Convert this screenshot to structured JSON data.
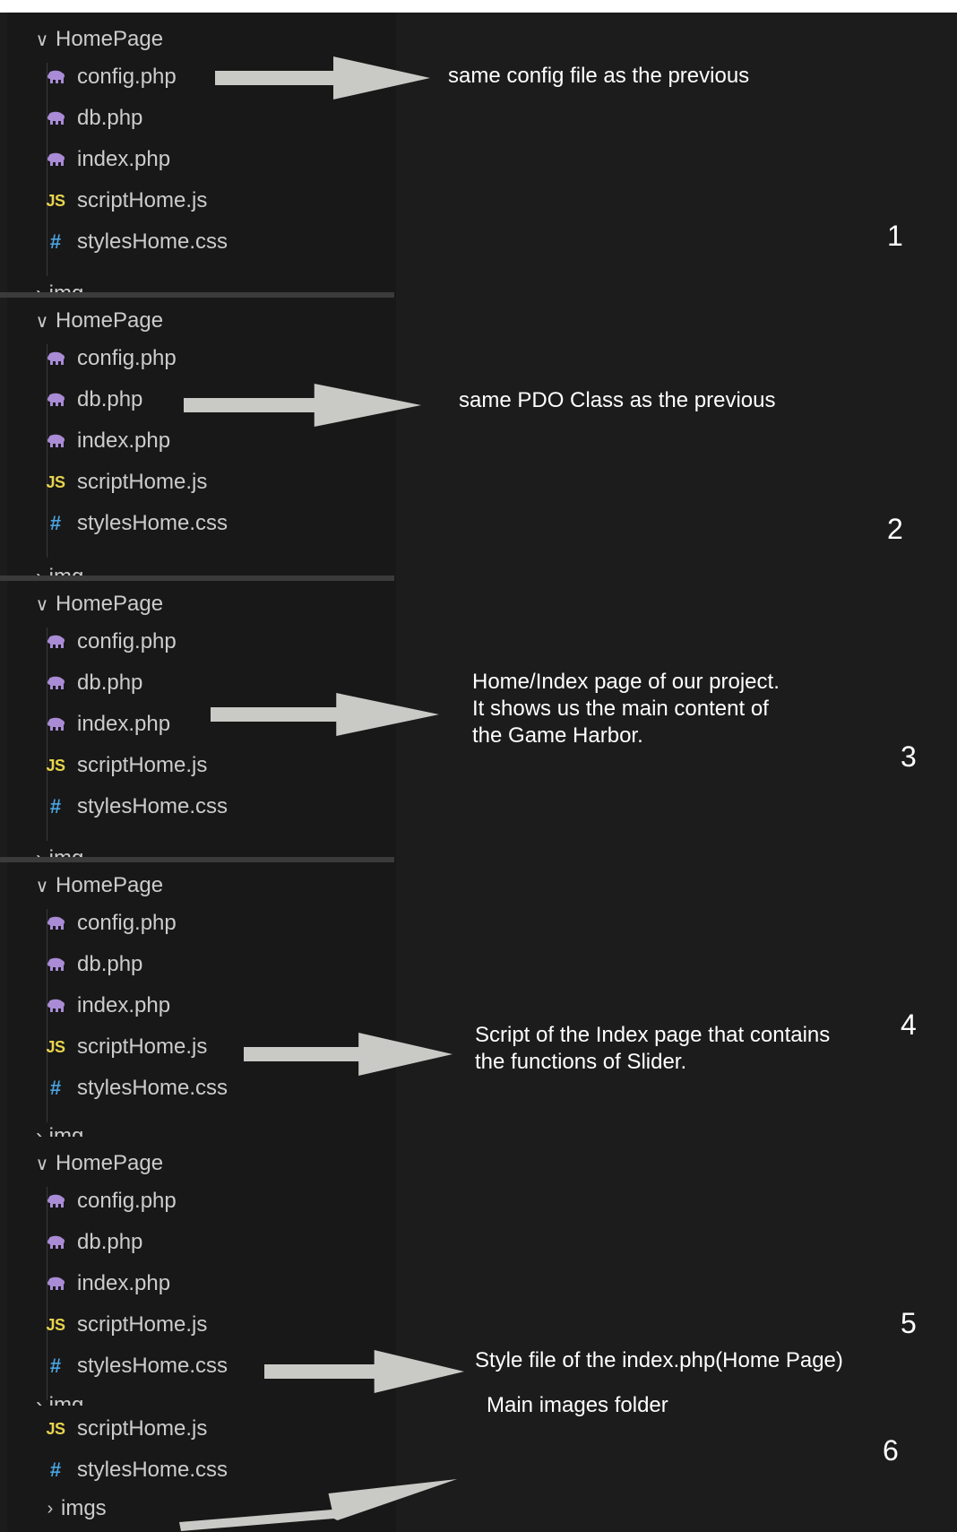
{
  "folder": {
    "name": "HomePage",
    "collapsed_sub": "img"
  },
  "files": [
    {
      "name": "config.php",
      "icon": "php-elephant-icon"
    },
    {
      "name": "db.php",
      "icon": "php-elephant-icon"
    },
    {
      "name": "index.php",
      "icon": "php-elephant-icon"
    },
    {
      "name": "scriptHome.js",
      "icon": "js-icon"
    },
    {
      "name": "stylesHome.css",
      "icon": "css-hash-icon"
    }
  ],
  "panels": [
    {
      "number": "1",
      "annotation": [
        "same config file as the previous"
      ]
    },
    {
      "number": "2",
      "annotation": [
        "same PDO Class as the previous"
      ]
    },
    {
      "number": "3",
      "annotation": [
        "Home/Index page of our project.",
        "It shows us the main content of",
        "the Game Harbor."
      ]
    },
    {
      "number": "4",
      "annotation": [
        "Script of the Index page that contains",
        "the functions of Slider."
      ]
    },
    {
      "number": "5",
      "annotation": [
        "Style file of the index.php(Home Page)"
      ]
    },
    {
      "number": "6",
      "annotation": [
        "Main images folder"
      ]
    }
  ],
  "panel6": {
    "files": [
      {
        "name": "scriptHome.js",
        "icon": "js-icon"
      },
      {
        "name": "stylesHome.css",
        "icon": "css-hash-icon"
      }
    ],
    "folder": "imgs"
  },
  "colors": {
    "background": "#1c1c1c",
    "explorer_bg": "#181818",
    "php_icon": "#a98bd6",
    "js_icon": "#e8d44d",
    "css_icon": "#4aa3df",
    "arrow": "#c9c9c6"
  },
  "labels": {
    "js_glyph": "JS",
    "css_glyph": "#",
    "chevron_down": "∨",
    "chevron_right": "›"
  }
}
